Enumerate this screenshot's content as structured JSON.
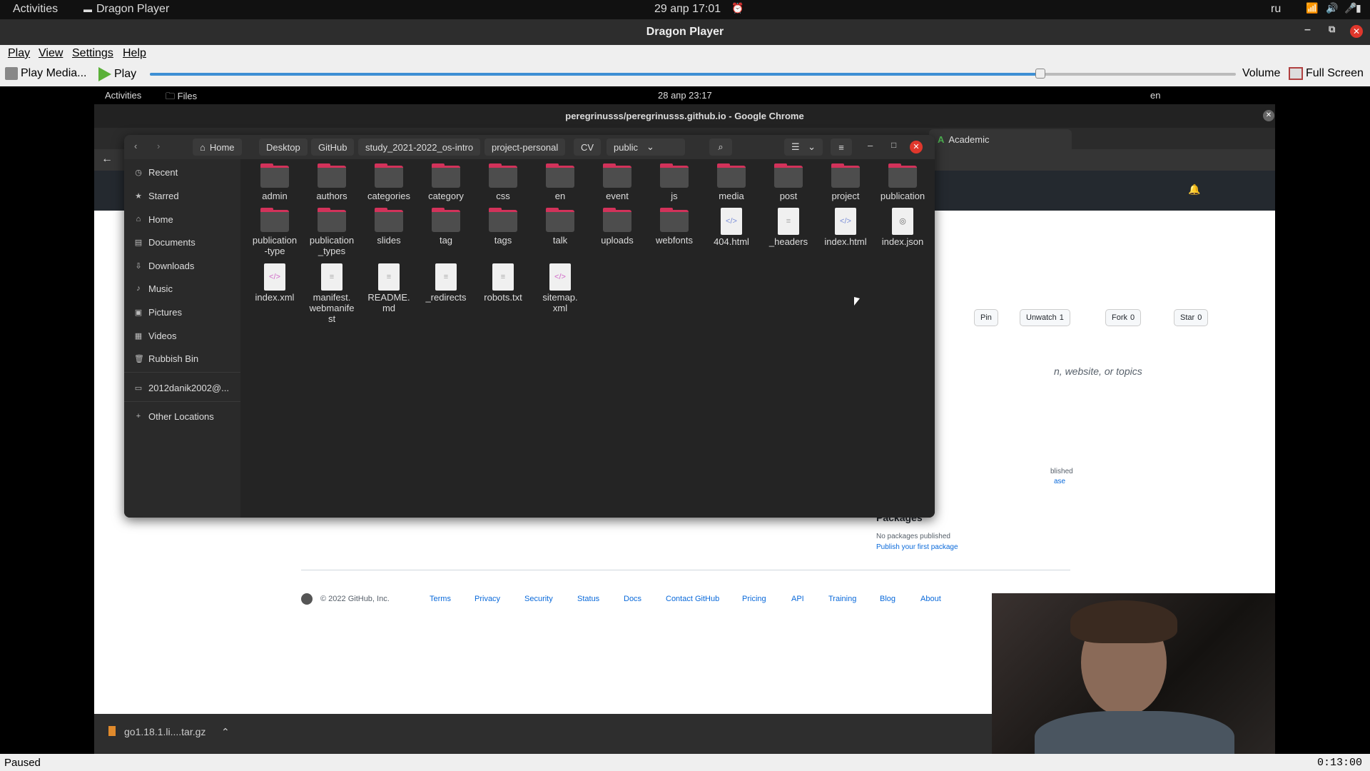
{
  "topbar": {
    "activities": "Activities",
    "app_name": "Dragon Player",
    "clock": "29 апр  17:01",
    "lang": "ru"
  },
  "player": {
    "title": "Dragon Player",
    "menu": [
      "Play",
      "View",
      "Settings",
      "Help"
    ],
    "play_media": "Play Media...",
    "play": "Play",
    "volume": "Volume",
    "fullscreen": "Full Screen",
    "status": "Paused",
    "time": "0:13:00",
    "progress_fraction": 0.82
  },
  "inner": {
    "topbar": {
      "activities": "Activities",
      "files": "Files",
      "clock": "28 апр  23:17",
      "lang": "en"
    },
    "chrome_title": "peregrinusss/peregrinusss.github.io - Google Chrome",
    "tab_academic": "Academic",
    "github": {
      "pin": "Pin",
      "unwatch": "Unwatch",
      "unwatch_count": "1",
      "fork": "Fork",
      "fork_count": "0",
      "star": "Star",
      "star_count": "0",
      "about_placeholder": "n, website, or topics",
      "releases_partial": "blished",
      "releases_link_partial": "ase",
      "packages_title": "Packages",
      "packages_none": "No packages published",
      "packages_link": "Publish your first package",
      "copyright": "© 2022 GitHub, Inc.",
      "footer": [
        "Terms",
        "Privacy",
        "Security",
        "Status",
        "Docs",
        "Contact GitHub",
        "Pricing",
        "API",
        "Training",
        "Blog",
        "About"
      ]
    },
    "download_item": "go1.18.1.li....tar.gz"
  },
  "files": {
    "breadcrumbs": [
      "Home",
      "Desktop",
      "GitHub",
      "study_2021-2022_os-intro",
      "project-personal",
      "CV",
      "public"
    ],
    "sidebar": [
      "Recent",
      "Starred",
      "Home",
      "Documents",
      "Downloads",
      "Music",
      "Pictures",
      "Videos",
      "Rubbish Bin",
      "2012danik2002@...",
      "Other Locations"
    ],
    "items": [
      {
        "name": "admin",
        "type": "folder"
      },
      {
        "name": "authors",
        "type": "folder"
      },
      {
        "name": "categories",
        "type": "folder"
      },
      {
        "name": "category",
        "type": "folder"
      },
      {
        "name": "css",
        "type": "folder"
      },
      {
        "name": "en",
        "type": "folder"
      },
      {
        "name": "event",
        "type": "folder"
      },
      {
        "name": "js",
        "type": "folder"
      },
      {
        "name": "media",
        "type": "folder"
      },
      {
        "name": "post",
        "type": "folder"
      },
      {
        "name": "project",
        "type": "folder"
      },
      {
        "name": "publication",
        "type": "folder"
      },
      {
        "name": "publication\n-type",
        "type": "folder"
      },
      {
        "name": "publication\n_types",
        "type": "folder"
      },
      {
        "name": "slides",
        "type": "folder"
      },
      {
        "name": "tag",
        "type": "folder"
      },
      {
        "name": "tags",
        "type": "folder"
      },
      {
        "name": "talk",
        "type": "folder"
      },
      {
        "name": "uploads",
        "type": "folder"
      },
      {
        "name": "webfonts",
        "type": "folder"
      },
      {
        "name": "404.html",
        "type": "code"
      },
      {
        "name": "_headers",
        "type": "text"
      },
      {
        "name": "index.html",
        "type": "code"
      },
      {
        "name": "index.json",
        "type": "json"
      },
      {
        "name": "index.xml",
        "type": "code-pink"
      },
      {
        "name": "manifest.\nwebmanife\nst",
        "type": "text"
      },
      {
        "name": "README.\nmd",
        "type": "text"
      },
      {
        "name": "_redirects",
        "type": "text"
      },
      {
        "name": "robots.txt",
        "type": "text"
      },
      {
        "name": "sitemap.\nxml",
        "type": "code-pink"
      }
    ]
  },
  "colors": {
    "seek_fill": "#3d8fd4",
    "folder_accent": "#d2325a",
    "close_red": "#e0372c"
  }
}
